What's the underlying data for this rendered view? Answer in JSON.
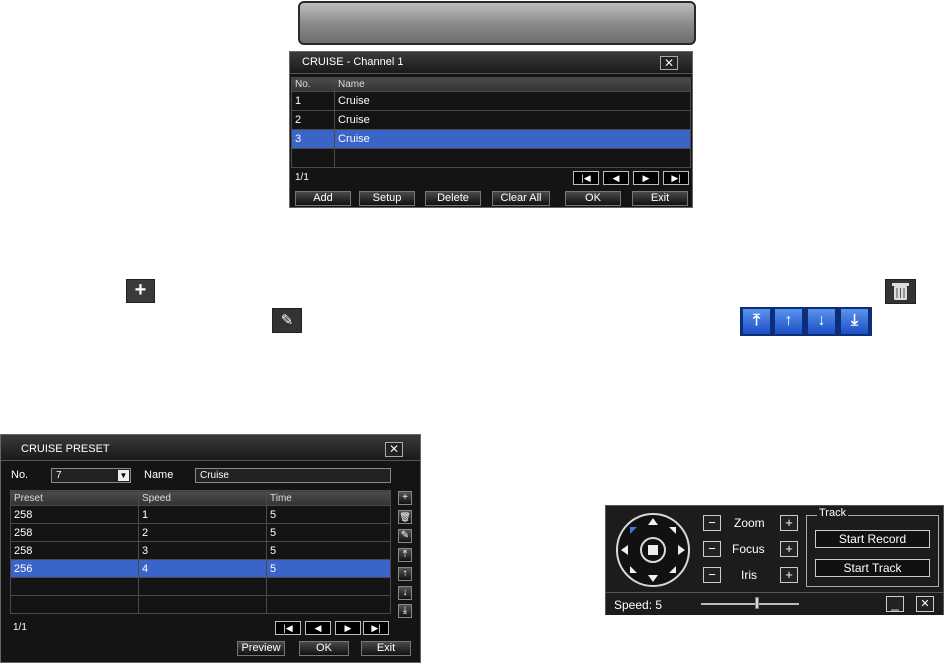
{
  "cruise_dialog": {
    "title": "CRUISE - Channel 1",
    "close": "✕",
    "columns": [
      "No.",
      "Name"
    ],
    "rows": [
      {
        "no": "1",
        "name": "Cruise"
      },
      {
        "no": "2",
        "name": "Cruise"
      },
      {
        "no": "3",
        "name": "Cruise"
      }
    ],
    "selected_row": 3,
    "page": "1/1",
    "buttons": {
      "add": "Add",
      "setup": "Setup",
      "delete": "Delete",
      "clear_all": "Clear All",
      "ok": "OK",
      "exit": "Exit"
    }
  },
  "icons": {
    "add": "plus-icon",
    "edit": "pencil-icon",
    "delete": "trash-icon",
    "move": [
      "move-top-icon",
      "move-up-icon",
      "move-down-icon",
      "move-bottom-icon"
    ]
  },
  "preset_dialog": {
    "title": "CRUISE PRESET",
    "close": "✕",
    "no_label": "No.",
    "no_value": "7",
    "name_label": "Name",
    "name_value": "Cruise",
    "columns": [
      "Preset",
      "Speed",
      "Time"
    ],
    "rows": [
      {
        "preset": "258",
        "speed": "1",
        "time": "5"
      },
      {
        "preset": "258",
        "speed": "2",
        "time": "5"
      },
      {
        "preset": "258",
        "speed": "3",
        "time": "5"
      },
      {
        "preset": "256",
        "speed": "4",
        "time": "5"
      }
    ],
    "selected_row": 4,
    "page": "1/1",
    "buttons": {
      "preview": "Preview",
      "ok": "OK",
      "exit": "Exit"
    }
  },
  "ptz_panel": {
    "zoom": "Zoom",
    "focus": "Focus",
    "iris": "Iris",
    "track_label": "Track",
    "start_record": "Start Record",
    "start_track": "Start Track",
    "speed_text": "Speed: 5",
    "speed_value": 5,
    "speed_min": 1,
    "speed_max": 8
  },
  "colors": {
    "selection": "#3a64c8",
    "dialog_bg": "#141414",
    "blue_button": "#2f6ce0"
  }
}
